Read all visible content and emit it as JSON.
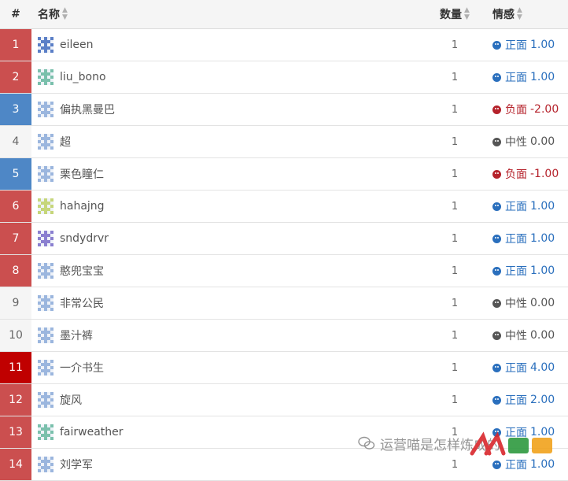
{
  "header": {
    "index": "#",
    "name": "名称",
    "count": "数量",
    "sentiment": "情感"
  },
  "colors": {
    "red": "#cb4f4f",
    "blue": "#4e87c6",
    "darkred": "#c00000",
    "plain": "#f5f5f5"
  },
  "rows": [
    {
      "index": "1",
      "name": "eileen",
      "count": "1",
      "label": "正面",
      "score": "1.00",
      "type": "pos",
      "idx_color": "#cb4f4f",
      "avatar": "#5b7fc7"
    },
    {
      "index": "2",
      "name": "liu_bono",
      "count": "1",
      "label": "正面",
      "score": "1.00",
      "type": "pos",
      "idx_color": "#cb4f4f",
      "avatar": "#7ac0ac"
    },
    {
      "index": "3",
      "name": "偏执黑曼巴",
      "count": "1",
      "label": "负面",
      "score": "-2.00",
      "type": "neg",
      "idx_color": "#4e87c6",
      "avatar": "#9bb6de"
    },
    {
      "index": "4",
      "name": "超",
      "count": "1",
      "label": "中性",
      "score": "0.00",
      "type": "neu",
      "idx_color": "#f5f5f5",
      "avatar": "#9bb6de"
    },
    {
      "index": "5",
      "name": "栗色瞳仁",
      "count": "1",
      "label": "负面",
      "score": "-1.00",
      "type": "neg",
      "idx_color": "#4e87c6",
      "avatar": "#9bb6de"
    },
    {
      "index": "6",
      "name": "hahajng",
      "count": "1",
      "label": "正面",
      "score": "1.00",
      "type": "pos",
      "idx_color": "#cb4f4f",
      "avatar": "#c6d67a"
    },
    {
      "index": "7",
      "name": "sndydrvr",
      "count": "1",
      "label": "正面",
      "score": "1.00",
      "type": "pos",
      "idx_color": "#cb4f4f",
      "avatar": "#8a7fd0"
    },
    {
      "index": "8",
      "name": "憨兜宝宝",
      "count": "1",
      "label": "正面",
      "score": "1.00",
      "type": "pos",
      "idx_color": "#cb4f4f",
      "avatar": "#9bb6de"
    },
    {
      "index": "9",
      "name": "非常公民",
      "count": "1",
      "label": "中性",
      "score": "0.00",
      "type": "neu",
      "idx_color": "#f5f5f5",
      "avatar": "#9bb6de"
    },
    {
      "index": "10",
      "name": "墨汁裤",
      "count": "1",
      "label": "中性",
      "score": "0.00",
      "type": "neu",
      "idx_color": "#f5f5f5",
      "avatar": "#9bb6de"
    },
    {
      "index": "11",
      "name": "一介书生",
      "count": "1",
      "label": "正面",
      "score": "4.00",
      "type": "pos",
      "idx_color": "#c00000",
      "avatar": "#9bb6de"
    },
    {
      "index": "12",
      "name": "旋风",
      "count": "1",
      "label": "正面",
      "score": "2.00",
      "type": "pos",
      "idx_color": "#cb4f4f",
      "avatar": "#9bb6de"
    },
    {
      "index": "13",
      "name": "fairweather",
      "count": "1",
      "label": "正面",
      "score": "1.00",
      "type": "pos",
      "idx_color": "#cb4f4f",
      "avatar": "#7ac0ac"
    },
    {
      "index": "14",
      "name": "刘学军",
      "count": "1",
      "label": "正面",
      "score": "1.00",
      "type": "pos",
      "idx_color": "#cb4f4f",
      "avatar": "#9bb6de"
    }
  ],
  "watermark": {
    "text": "运营喵是怎样炼成的",
    "logo": "人人都是产品经理"
  }
}
